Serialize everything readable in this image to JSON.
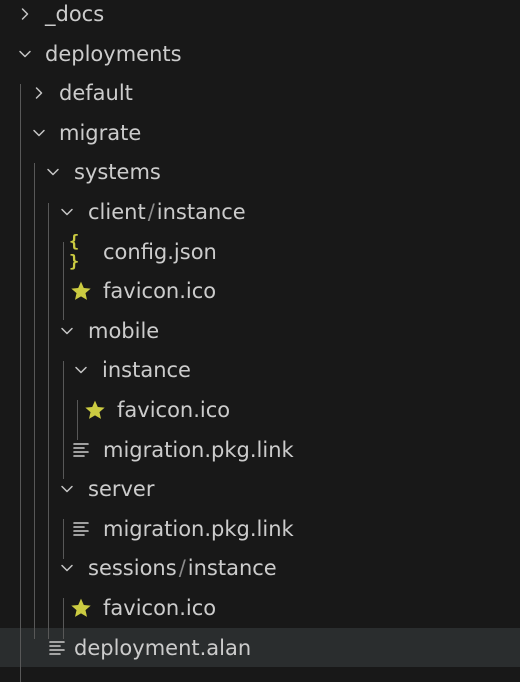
{
  "explorer": {
    "items": [
      {
        "label": "_docs",
        "type": "folder",
        "expanded": false
      },
      {
        "label": "deployments",
        "type": "folder",
        "expanded": true
      },
      {
        "label": "default",
        "type": "folder",
        "expanded": false
      },
      {
        "label": "migrate",
        "type": "folder",
        "expanded": true
      },
      {
        "label": "systems",
        "type": "folder",
        "expanded": true
      },
      {
        "label": "client",
        "label2": "instance",
        "type": "folder",
        "expanded": true
      },
      {
        "label": "config.json",
        "type": "file",
        "icon": "json-braces-icon"
      },
      {
        "label": "favicon.ico",
        "type": "file",
        "icon": "star-icon"
      },
      {
        "label": "mobile",
        "type": "folder",
        "expanded": true
      },
      {
        "label": "instance",
        "type": "folder",
        "expanded": true
      },
      {
        "label": "favicon.ico",
        "type": "file",
        "icon": "star-icon"
      },
      {
        "label": "migration.pkg.link",
        "type": "file",
        "icon": "lines-icon"
      },
      {
        "label": "server",
        "type": "folder",
        "expanded": true
      },
      {
        "label": "migration.pkg.link",
        "type": "file",
        "icon": "lines-icon"
      },
      {
        "label": "sessions",
        "label2": "instance",
        "type": "folder",
        "expanded": true
      },
      {
        "label": "favicon.ico",
        "type": "file",
        "icon": "star-icon"
      },
      {
        "label": "deployment.alan",
        "type": "file",
        "icon": "lines-icon",
        "selected": true
      }
    ],
    "compact_separator": "/",
    "json_icon_glyph": "{ }",
    "colors": {
      "background": "#181818",
      "text": "#cccccc",
      "selected_row": "#2a2d2e",
      "indent_guide": "#585858",
      "json_icon": "#cbcb41",
      "star_icon": "#cbcb41",
      "lines_icon": "#cccccc"
    }
  }
}
